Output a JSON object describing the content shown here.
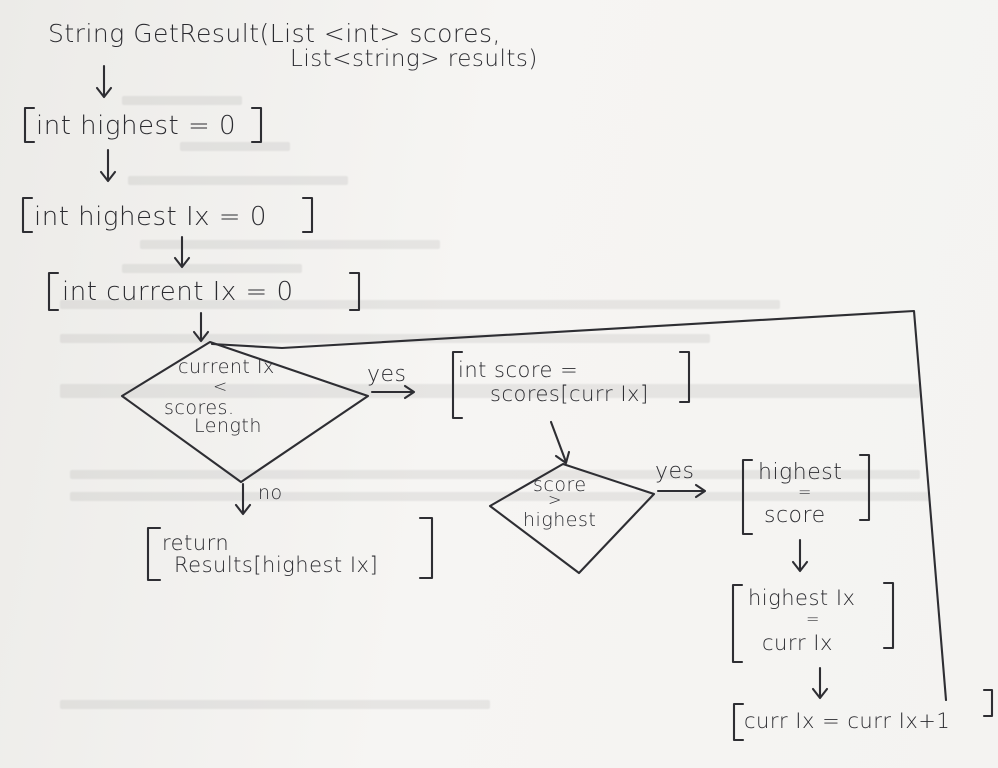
{
  "signature": {
    "line1": "String GetResult(List <int> scores,",
    "line2": "List<string> results)"
  },
  "steps": {
    "init_highest": "int highest = 0",
    "init_highest_ix": "int highest Ix = 0",
    "init_current_ix": "int current Ix = 0",
    "loop_condition": {
      "left": "current Ix",
      "op": "<",
      "right_1": "scores.",
      "right_2": "Length"
    },
    "loop_yes": "yes",
    "loop_no": "no",
    "return": {
      "line1": "return",
      "line2": "Results[highest Ix]"
    },
    "score_assign": {
      "line1": "int score =",
      "line2": "scores[curr Ix]"
    },
    "compare": {
      "left": "score",
      "op": ">",
      "right": "highest"
    },
    "compare_yes": "yes",
    "set_highest": {
      "line1": "highest",
      "op": "=",
      "line2": "score"
    },
    "set_highest_ix": {
      "line1": "highest Ix",
      "op": "=",
      "line2": "curr Ix"
    },
    "increment": "curr Ix = curr Ix+1"
  },
  "colors": {
    "ink": "#2e2e33",
    "paper": "#f3f2f0"
  }
}
